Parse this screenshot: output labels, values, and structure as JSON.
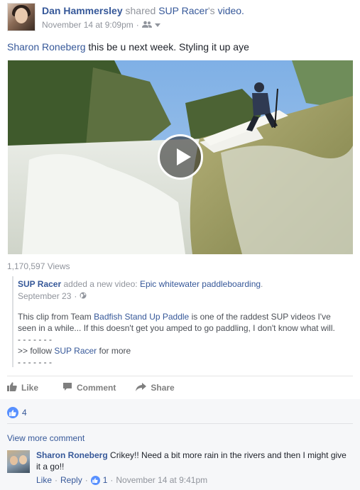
{
  "post": {
    "author": "Dan Hammersley",
    "shared_word": "shared",
    "shared_page": "SUP Racer",
    "shared_suffix": "'s",
    "shared_object": "video.",
    "timestamp": "November 14 at 9:09pm",
    "tagged_user": "Sharon Roneberg",
    "text": " this be u next week. Styling it up aye"
  },
  "video": {
    "views": "1,170,597 Views"
  },
  "shared_content": {
    "source": "SUP Racer",
    "added_text": "added a new video:",
    "video_title": "Epic whitewater paddleboarding",
    "title_suffix": ".",
    "date": "September 23",
    "body_line1_a": "This clip from Team ",
    "body_line1_link": "Badfish Stand Up Paddle",
    "body_line1_b": " is one of the raddest SUP videos I've",
    "body_line2": "seen in a while... If this doesn't get you amped to go paddling, I don't know what will.",
    "body_line3": "- - - - - - -",
    "body_line4_a": ">> follow ",
    "body_line4_link": "SUP Racer",
    "body_line4_b": " for more",
    "body_line5": "- - - - - - -"
  },
  "actions": {
    "like": "Like",
    "comment": "Comment",
    "share": "Share"
  },
  "reactions": {
    "like_count": "4"
  },
  "comments": {
    "view_more": "View more comment",
    "items": [
      {
        "name": "Sharon Roneberg",
        "text": " Crikey!! Need a bit more rain in the rivers and then I might give it a go!!",
        "like_label": "Like",
        "reply_label": "Reply",
        "sep": "·",
        "like_count": "1",
        "time": "November 14 at 9:41pm"
      }
    ]
  },
  "colors": {
    "link": "#365899",
    "muted": "#90949c",
    "like_blue": "#5890ff"
  }
}
